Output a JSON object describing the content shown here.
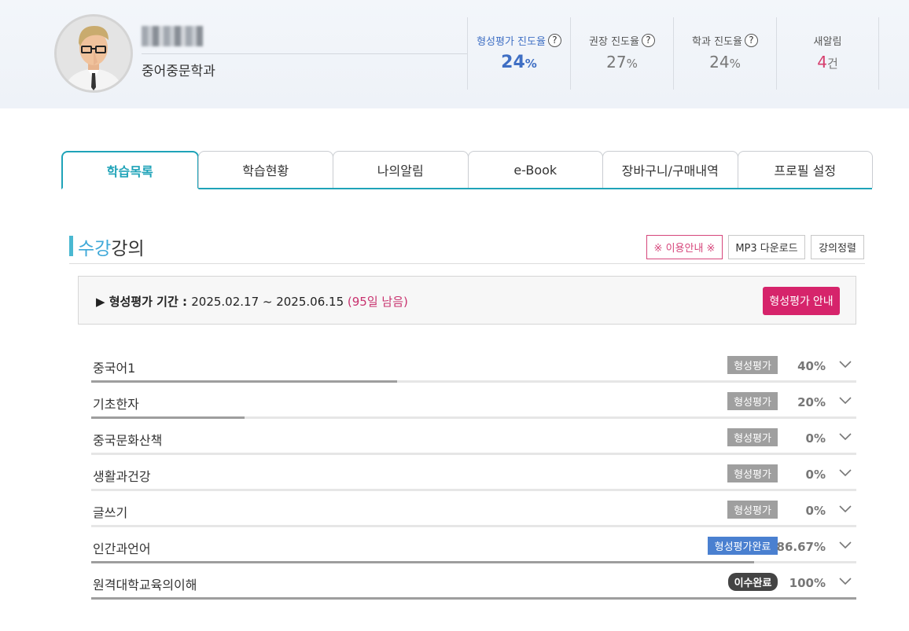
{
  "header": {
    "department": "중어중문학과",
    "stats": [
      {
        "label": "형성평가 진도율",
        "num": "24",
        "unit": "%",
        "help": "?"
      },
      {
        "label": "권장 진도율",
        "num": "27",
        "unit": "%",
        "help": "?"
      },
      {
        "label": "학과 진도율",
        "num": "24",
        "unit": "%",
        "help": "?"
      },
      {
        "label": "새알림",
        "num": "4",
        "unit": "건"
      }
    ]
  },
  "tabs": [
    "학습목록",
    "학습현황",
    "나의알림",
    "e-Book",
    "장바구니/구매내역",
    "프로필 설정"
  ],
  "section": {
    "title_accent": "수강",
    "title_rest": "강의",
    "buttons": {
      "guide": "※ 이용안내 ※",
      "mp3": "MP3 다운로드",
      "sort": "강의정렬"
    }
  },
  "evaluation": {
    "prefix": "▶ 형성평가 기간 : ",
    "period": "2025.02.17 ~ 2025.06.15",
    "remaining": "(95일 남음)",
    "button": "형성평가 안내"
  },
  "courses": [
    {
      "name": "중국어1",
      "badge": "형성평가",
      "badge_type": "normal",
      "percent_label": "40%",
      "progress": 0.4
    },
    {
      "name": "기초한자",
      "badge": "형성평가",
      "badge_type": "normal",
      "percent_label": "20%",
      "progress": 0.2
    },
    {
      "name": "중국문화산책",
      "badge": "형성평가",
      "badge_type": "normal",
      "percent_label": "0%",
      "progress": 0
    },
    {
      "name": "생활과건강",
      "badge": "형성평가",
      "badge_type": "normal",
      "percent_label": "0%",
      "progress": 0
    },
    {
      "name": "글쓰기",
      "badge": "형성평가",
      "badge_type": "normal",
      "percent_label": "0%",
      "progress": 0
    },
    {
      "name": "인간과언어",
      "badge": "형성평가완료",
      "badge_type": "done",
      "percent_label": "86.67%",
      "progress": 0.8667
    },
    {
      "name": "원격대학교육의이해",
      "badge": "이수완료",
      "badge_type": "complete",
      "percent_label": "100%",
      "progress": 1.0
    }
  ],
  "colors": {
    "accent_teal": "#1fa3b8",
    "accent_blue": "#3f6fc4",
    "accent_pink": "#d6246b"
  }
}
